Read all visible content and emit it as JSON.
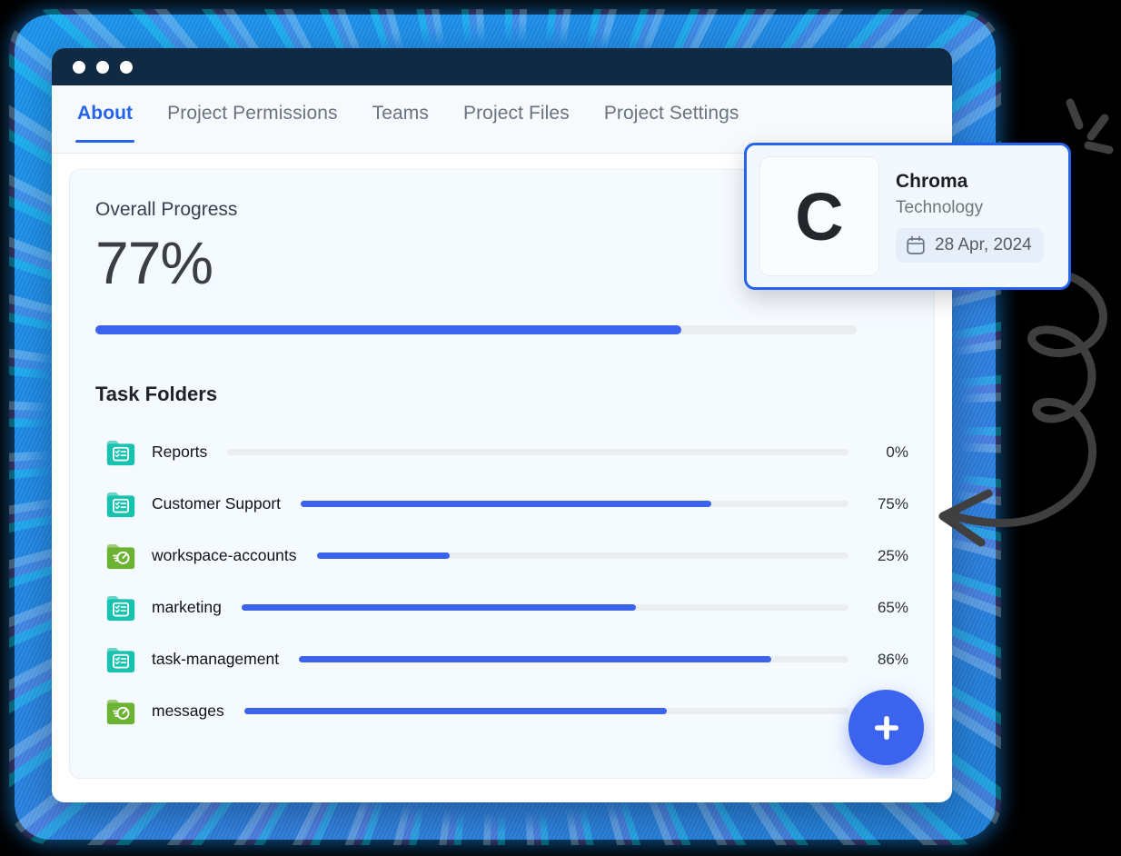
{
  "window": {
    "traffic_lights": [
      "close-dot",
      "minimize-dot",
      "maximize-dot"
    ]
  },
  "tabs": [
    {
      "label": "About",
      "active": true
    },
    {
      "label": "Project Permissions",
      "active": false
    },
    {
      "label": "Teams",
      "active": false
    },
    {
      "label": "Project Files",
      "active": false
    },
    {
      "label": "Project Settings",
      "active": false
    }
  ],
  "overall": {
    "label": "Overall Progress",
    "value_text": "77%",
    "value": 77
  },
  "task_folders": {
    "title": "Task Folders",
    "items": [
      {
        "name": "Reports",
        "percent_text": "0%",
        "percent": 0,
        "icon": "folder-checklist-icon",
        "icon_color": "#18c2ae"
      },
      {
        "name": "Customer Support",
        "percent_text": "75%",
        "percent": 75,
        "icon": "folder-checklist-icon",
        "icon_color": "#18c2ae"
      },
      {
        "name": "workspace-accounts",
        "percent_text": "25%",
        "percent": 25,
        "icon": "folder-speed-icon",
        "icon_color": "#6cb233"
      },
      {
        "name": "marketing",
        "percent_text": "65%",
        "percent": 65,
        "icon": "folder-checklist-icon",
        "icon_color": "#18c2ae"
      },
      {
        "name": "task-management",
        "percent_text": "86%",
        "percent": 86,
        "icon": "folder-checklist-icon",
        "icon_color": "#18c2ae"
      },
      {
        "name": "messages",
        "percent_text": "",
        "percent": 70,
        "icon": "folder-speed-icon",
        "icon_color": "#6cb233"
      }
    ]
  },
  "add_button": {
    "icon": "plus-icon",
    "label": "+"
  },
  "chroma_card": {
    "logo_letter": "C",
    "name": "Chroma",
    "category": "Technology",
    "date": "28 Apr, 2024",
    "date_icon": "calendar-icon"
  },
  "colors": {
    "accent_blue": "#3b63ee",
    "tab_active": "#2563eb",
    "titlebar": "#102a43",
    "folder_teal": "#18c2ae",
    "folder_green": "#6cb233",
    "track": "#ebedef"
  },
  "decoration": {
    "doodle": "curly-arrow-doodle"
  }
}
